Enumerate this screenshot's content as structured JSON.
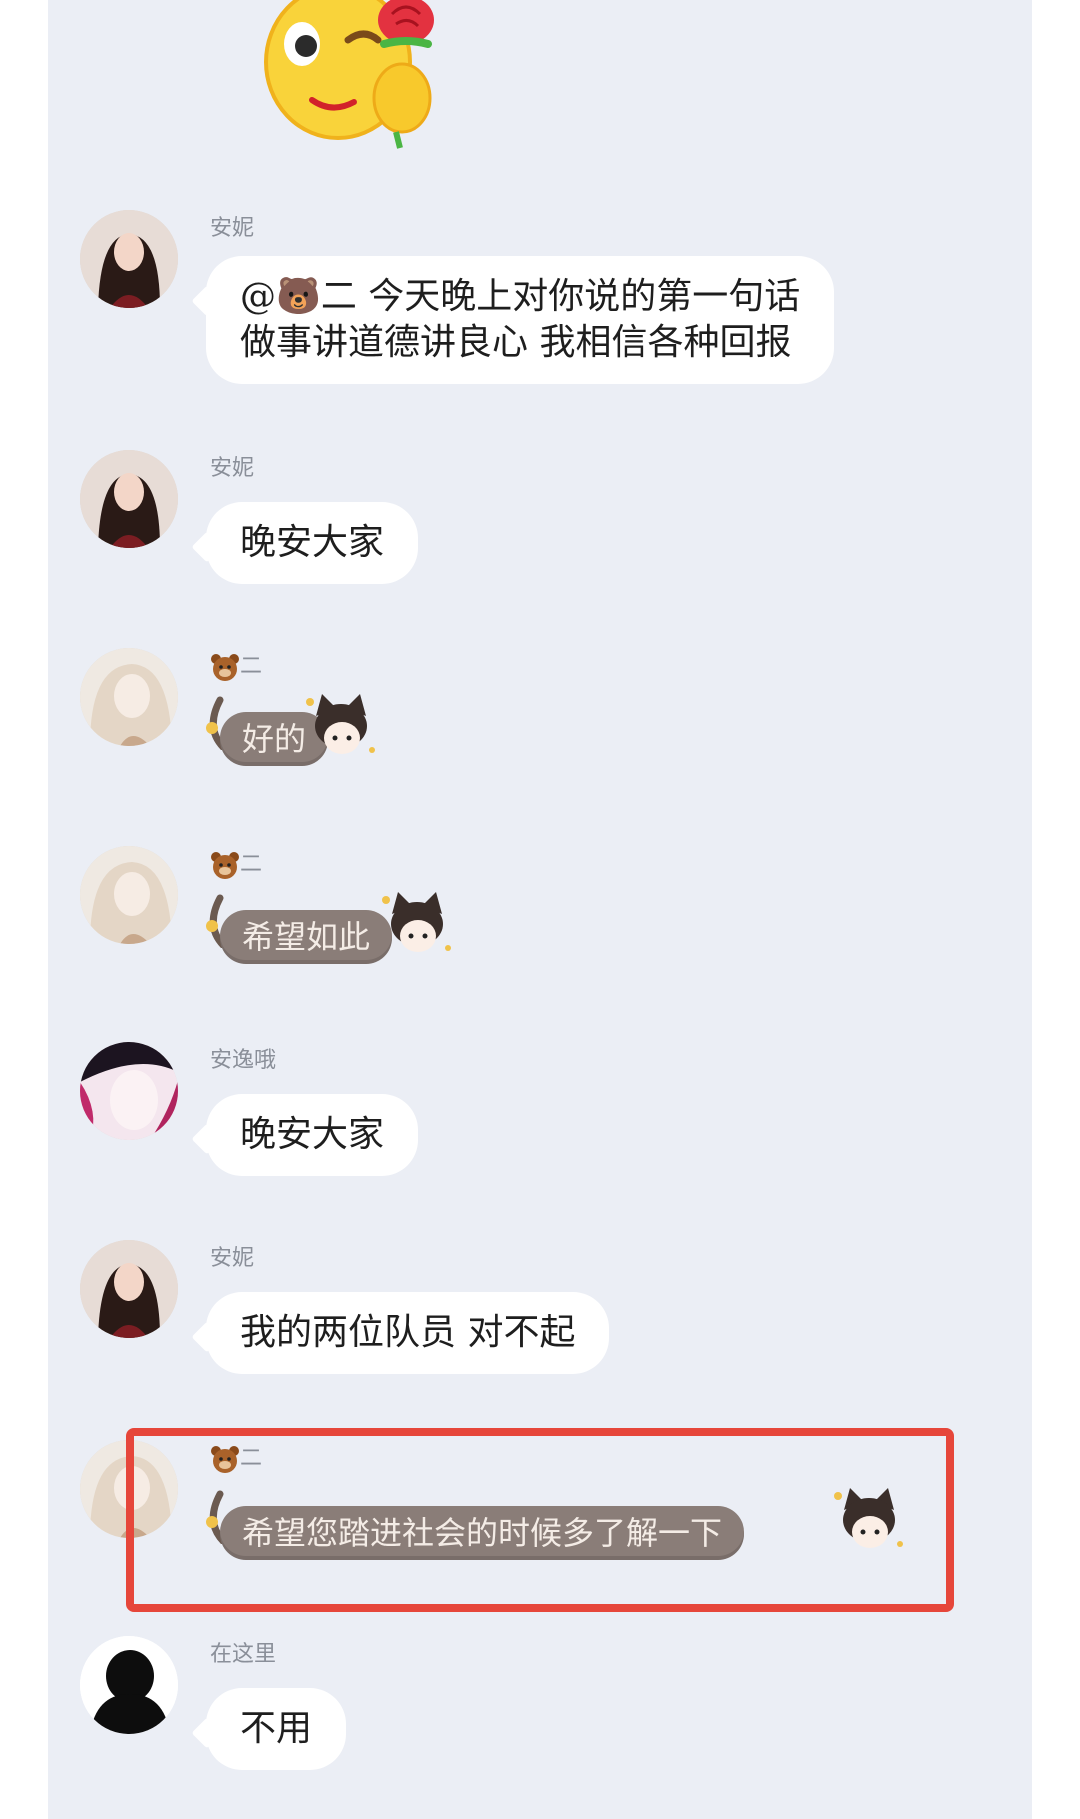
{
  "messages": [
    {
      "sender": "安妮",
      "avatar": "woman-dark-hair-avatar",
      "lines": [
        "@🐻二 今天晚上对你说的第一句话",
        "做事讲道德讲良心 我相信各种回报"
      ]
    },
    {
      "sender": "安妮",
      "avatar": "woman-dark-hair-avatar",
      "lines": [
        "晚安大家"
      ]
    },
    {
      "sender_suffix": "二",
      "avatar": "light-hair-avatar",
      "styled_text": "好的"
    },
    {
      "sender_suffix": "二",
      "avatar": "light-hair-avatar",
      "styled_text": "希望如此"
    },
    {
      "sender": "安逸哦",
      "avatar": "pink-figure-avatar",
      "lines": [
        "晚安大家"
      ]
    },
    {
      "sender": "安妮",
      "avatar": "woman-dark-hair-avatar",
      "lines": [
        "我的两位队员 对不起"
      ]
    },
    {
      "sender_suffix": "二",
      "avatar": "light-hair-avatar",
      "styled_text": "希望您踏进社会的时候多了解一下"
    },
    {
      "sender": "在这里",
      "avatar": "black-silhouette-avatar",
      "lines": [
        "不用"
      ]
    }
  ],
  "colors": {
    "panel": "#ebeef5",
    "bubble": "#ffffff",
    "styled_bubble": "#8a7d78",
    "highlight": "#e6463a"
  }
}
